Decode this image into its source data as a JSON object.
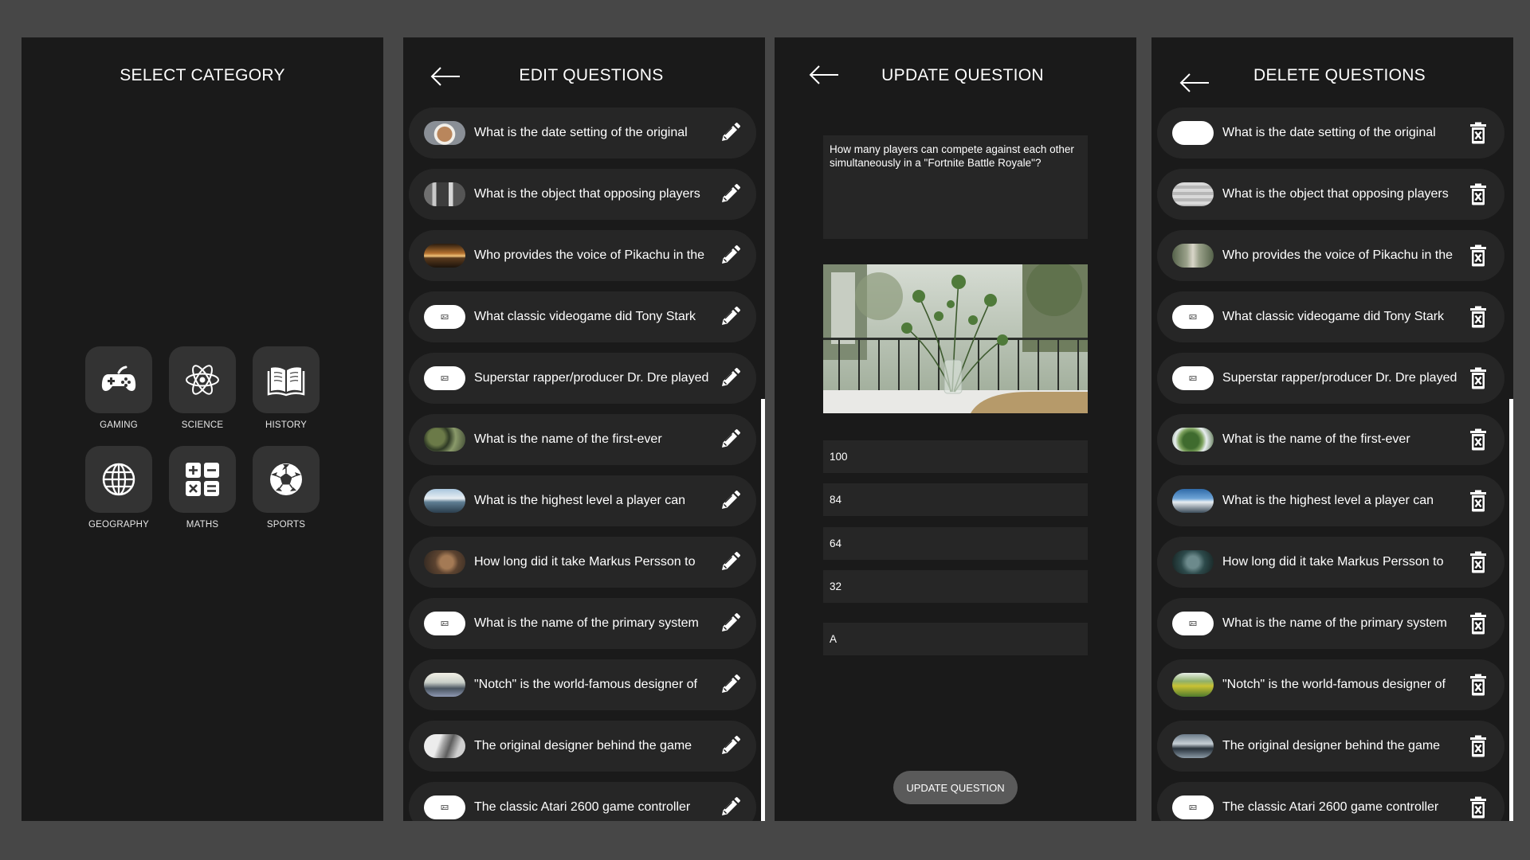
{
  "colors": {
    "outer_bg": "#474747",
    "panel_bg": "#1a1a1a",
    "row_bg": "#262626",
    "tile_bg": "#333333",
    "button_bg": "#5a5a5a",
    "text": "#ffffff"
  },
  "select_category": {
    "title": "SELECT CATEGORY",
    "categories": [
      {
        "label": "GAMING",
        "icon": "gamepad-icon"
      },
      {
        "label": "SCIENCE",
        "icon": "atom-icon"
      },
      {
        "label": "HISTORY",
        "icon": "book-icon"
      },
      {
        "label": "GEOGRAPHY",
        "icon": "globe-icon"
      },
      {
        "label": "MATHS",
        "icon": "calculator-icon"
      },
      {
        "label": "SPORTS",
        "icon": "soccer-ball-icon"
      }
    ]
  },
  "edit_questions": {
    "title": "EDIT QUESTIONS",
    "row_icon": "pencil-icon",
    "questions": [
      "What is the date setting of the original",
      "What is the object that opposing players",
      "Who provides the voice of Pikachu in the",
      "What classic videogame did Tony Stark",
      "Superstar rapper/producer Dr. Dre played",
      "What is the name of the first-ever",
      "What is the highest level a player can",
      "How long did it take Markus Persson to",
      "What is the name of the primary system",
      "\"Notch\" is the world-famous designer of",
      "The original designer behind the game",
      "The classic Atari 2600 game controller"
    ]
  },
  "update_question": {
    "title": "UPDATE QUESTION",
    "question_text": "How many players can compete against each other simultaneously in a \"Fortnite Battle Royale\"?",
    "image_icon": "plant-vase-photo",
    "options": [
      "100",
      "84",
      "64",
      "32"
    ],
    "answer": "A",
    "button_label": "UPDATE QUESTION"
  },
  "delete_questions": {
    "title": "DELETE QUESTIONS",
    "row_icon": "trash-icon",
    "questions": [
      "What is the date setting of the original",
      "What is the object that opposing players",
      "Who provides the voice of Pikachu in the",
      "What classic videogame did Tony Stark",
      "Superstar rapper/producer Dr. Dre played",
      "What is the name of the first-ever",
      "What is the highest level a player can",
      "How long did it take Markus Persson to",
      "What is the name of the primary system",
      "\"Notch\" is the world-famous designer of",
      "The original designer behind the game",
      "The classic Atari 2600 game controller"
    ]
  }
}
